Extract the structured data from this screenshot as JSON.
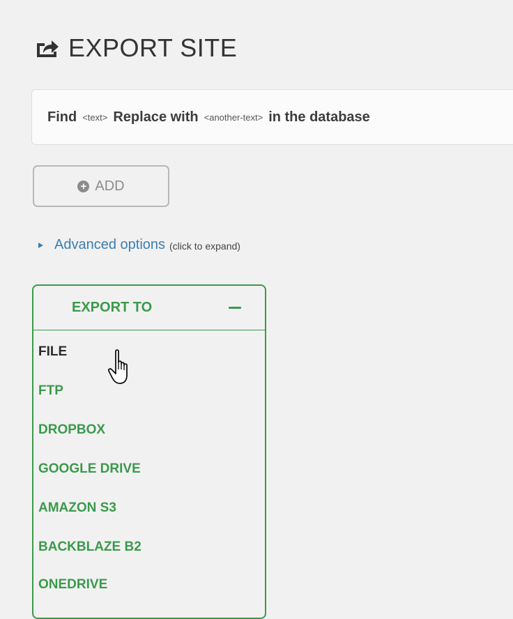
{
  "header": {
    "title": "EXPORT SITE"
  },
  "replace": {
    "find_label": "Find",
    "find_placeholder": "<text>",
    "replace_label": "Replace with",
    "replace_placeholder": "<another-text>",
    "suffix": "in the database"
  },
  "add_button": {
    "label": "ADD",
    "icon": "plus-circle-icon"
  },
  "advanced": {
    "link": "Advanced options",
    "hint": "(click to expand)"
  },
  "export": {
    "title": "EXPORT TO",
    "collapse_icon": "minus-icon",
    "destinations": [
      {
        "label": "FILE"
      },
      {
        "label": "FTP"
      },
      {
        "label": "DROPBOX"
      },
      {
        "label": "GOOGLE DRIVE"
      },
      {
        "label": "AMAZON S3"
      },
      {
        "label": "BACKBLAZE B2"
      },
      {
        "label": "ONEDRIVE"
      }
    ],
    "active_index": 0
  },
  "colors": {
    "accent_green": "#3a9a4b",
    "link_blue": "#3b7db3",
    "background": "#f1f1f1"
  },
  "cursor": "hand-pointer-icon"
}
